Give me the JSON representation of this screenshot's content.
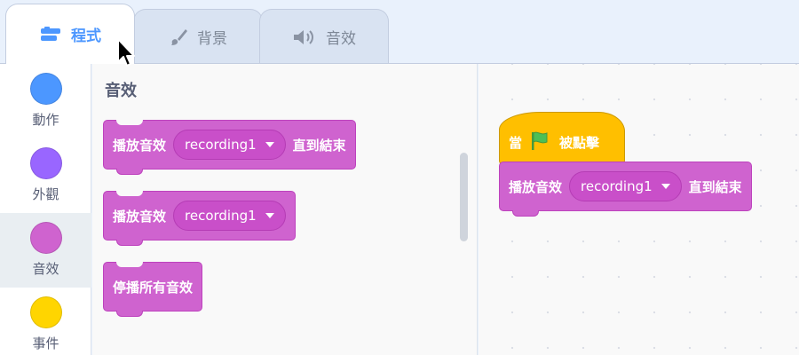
{
  "tabs": [
    {
      "label": "程式",
      "icon": "code-icon",
      "active": true
    },
    {
      "label": "背景",
      "icon": "paintbrush-icon",
      "active": false
    },
    {
      "label": "音效",
      "icon": "speaker-icon",
      "active": false
    }
  ],
  "categories": [
    {
      "label": "動作",
      "color": "#4c97ff"
    },
    {
      "label": "外觀",
      "color": "#9966ff"
    },
    {
      "label": "音效",
      "color": "#cf63cf",
      "selected": true
    },
    {
      "label": "事件",
      "color": "#ffd500"
    }
  ],
  "palette": {
    "title": "音效",
    "blocks": [
      {
        "text": "播放音效",
        "dropdown": "recording1",
        "suffix": "直到結束"
      },
      {
        "text": "播放音效",
        "dropdown": "recording1"
      },
      {
        "text": "停播所有音效"
      }
    ]
  },
  "script": {
    "hat": {
      "prefix": "當",
      "icon": "green-flag-icon",
      "suffix": "被點擊"
    },
    "block": {
      "text": "播放音效",
      "dropdown": "recording1",
      "suffix": "直到結束"
    }
  },
  "colors": {
    "sound": "#cf63cf",
    "events": "#ffbf00",
    "accent": "#4c97ff"
  }
}
